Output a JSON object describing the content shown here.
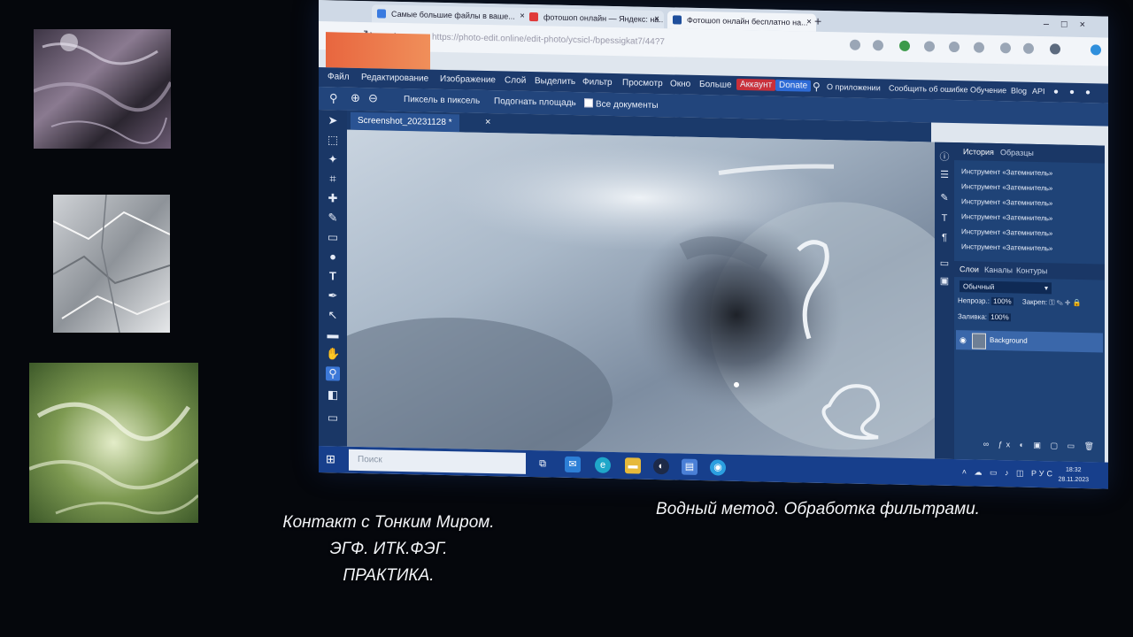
{
  "browser": {
    "tabs": [
      {
        "title": "Самые большие файлы в ваше...",
        "fav_color": "#3a7be0"
      },
      {
        "title": "фотошоп онлайн — Яндекс: на...",
        "fav_color": "#e03a3a"
      },
      {
        "title": "Фотошоп онлайн бесплатно на...",
        "fav_color": "#1f4f9c"
      }
    ],
    "new_tab": "+",
    "window_controls": "–□×",
    "nav": {
      "back": "‹",
      "refresh": "↻",
      "home": "⌂"
    },
    "url": "https://photo-edit.online/edit-photo/ycsicl-/bpessigkat7/44?7"
  },
  "app": {
    "menu": [
      "Файл",
      "Редактирование",
      "Изображение",
      "Слой",
      "Выделить",
      "Фильтр",
      "Просмотр",
      "Окно",
      "Больше"
    ],
    "account_label": "Аккаунт",
    "donate_label": "Donate",
    "right_menu": [
      "О приложении",
      "Сообщить об ошибке",
      "Обучение",
      "Blog",
      "API"
    ],
    "options": {
      "pixel_to_pixel": "Пиксель в пиксель",
      "fit_area": "Подогнать площадь",
      "all_documents": "Все документы"
    },
    "document_tab": "Screenshot_20231128",
    "document_tab_modified": "*",
    "document_close": "×",
    "history": {
      "tab_history": "История",
      "tab_samples": "Образцы",
      "items": [
        "Инструмент «Затемнитель»",
        "Инструмент «Затемнитель»",
        "Инструмент «Затемнитель»",
        "Инструмент «Затемнитель»",
        "Инструмент «Затемнитель»",
        "Инструмент «Затемнитель»"
      ]
    },
    "layers": {
      "tab_layers": "Слои",
      "tab_channels": "Каналы",
      "tab_paths": "Контуры",
      "blend_mode": "Обычный",
      "opacity_label": "Непрозр.:",
      "opacity_value": "100%",
      "lock_label": "Закреп:",
      "fill_label": "Заливка:",
      "fill_value": "100%",
      "layer_name": "Background"
    }
  },
  "taskbar": {
    "search_placeholder": "Поиск",
    "language": "РУС",
    "time": "18:32",
    "date": "28.11.2023"
  },
  "captions": {
    "left": [
      "Контакт с Тонким Миром.",
      "ЭГФ. ИТК.ФЭГ.",
      "ПРАКТИКА."
    ],
    "right": "Водный метод. Обработка фильтрами."
  }
}
